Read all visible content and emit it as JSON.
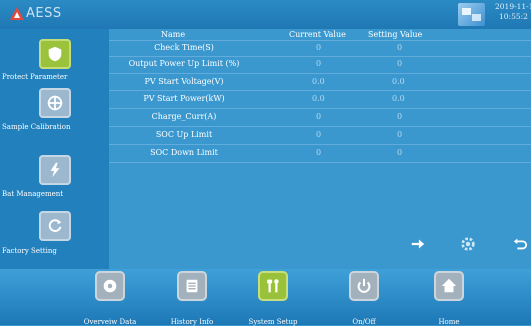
{
  "header": {
    "brand": "AESS",
    "datetime_line1": "2019-11-1",
    "datetime_line2": "10:55:2"
  },
  "sidebar": {
    "items": [
      {
        "label": "Protect Parameter",
        "icon": "shield-icon",
        "active": true
      },
      {
        "label": "Sample Calibration",
        "icon": "dial-icon",
        "active": false
      },
      {
        "label": "Bat Management",
        "icon": "lightning-icon",
        "active": false
      },
      {
        "label": "Factory Setting",
        "icon": "refresh-icon",
        "active": false
      }
    ]
  },
  "table": {
    "headers": {
      "name": "Name",
      "current": "Current Value",
      "setting": "Setting Value"
    },
    "rows": [
      {
        "name": "Check Time(S)",
        "current": "0",
        "setting": "0"
      },
      {
        "name": "Output Power Up Limit (%)",
        "current": "0",
        "setting": "0"
      },
      {
        "name": "PV Start Voltage(V)",
        "current": "0.0",
        "setting": "0.0"
      },
      {
        "name": "PV Start Power(kW)",
        "current": "0.0",
        "setting": "0.0"
      },
      {
        "name": "Charge_Curr(A)",
        "current": "0",
        "setting": "0"
      },
      {
        "name": "SOC Up Limit",
        "current": "0",
        "setting": "0"
      },
      {
        "name": "SOC Down Limit",
        "current": "0",
        "setting": "0"
      }
    ]
  },
  "actions": [
    "arrow-right-icon",
    "gear-icon",
    "return-icon"
  ],
  "bottom_nav": [
    {
      "label": "Overveiw Data",
      "icon": "disc-icon",
      "active": false
    },
    {
      "label": "History Info",
      "icon": "document-icon",
      "active": false
    },
    {
      "label": "System Setup",
      "icon": "tools-icon",
      "active": true
    },
    {
      "label": "On/Off",
      "icon": "power-icon",
      "active": false
    },
    {
      "label": "Home",
      "icon": "home-icon",
      "active": false
    }
  ],
  "colors": {
    "background": "#3a98cf",
    "sidebar": "#2280bd",
    "active_green": "#9bc23b",
    "logo_red": "#e24a3b"
  }
}
